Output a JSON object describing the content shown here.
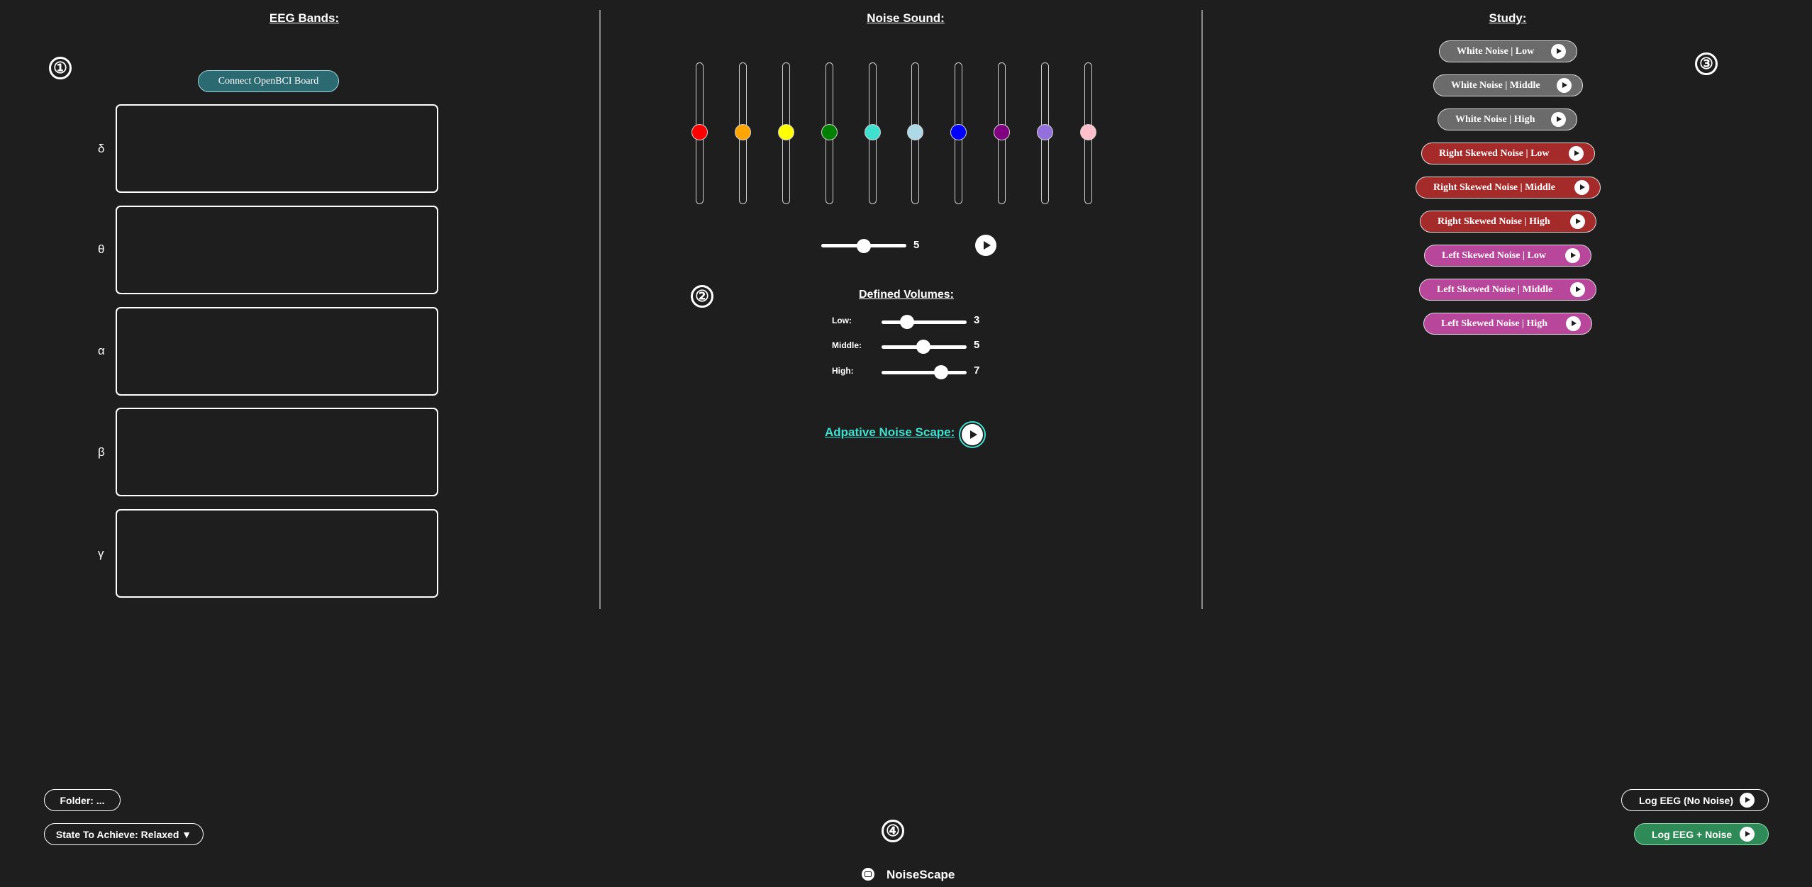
{
  "sections": {
    "eeg_title": "EEG Bands:",
    "noise_title": "Noise Sound:",
    "study_title": "Study:"
  },
  "markers": [
    "①",
    "②",
    "③",
    "④"
  ],
  "eeg": {
    "connect_label": "Connect OpenBCI Board",
    "bands": [
      "δ",
      "θ",
      "α",
      "β",
      "γ"
    ]
  },
  "noise": {
    "slider_colors": [
      "#ff0000",
      "#ffa500",
      "#ffff00",
      "#008000",
      "#40e0d0",
      "#add8e6",
      "#0000ff",
      "#800080",
      "#9370db",
      "#ffc0cb"
    ],
    "master_volume": "5",
    "defined_volumes_title": "Defined Volumes:",
    "volumes": [
      {
        "label": "Low:",
        "value": "3"
      },
      {
        "label": "Middle:",
        "value": "5"
      },
      {
        "label": "High:",
        "value": "7"
      }
    ],
    "adaptive_label": "Adpative Noise Scape:",
    "adaptive_color": "#40e0d0"
  },
  "study": {
    "buttons": [
      {
        "label": "White Noise | Low",
        "color": "#6b6b6b"
      },
      {
        "label": "White Noise | Middle",
        "color": "#6b6b6b"
      },
      {
        "label": "White Noise | High",
        "color": "#6b6b6b"
      },
      {
        "label": "Right Skewed Noise | Low",
        "color": "#a52a2a"
      },
      {
        "label": "Right Skewed Noise | Middle",
        "color": "#a52a2a"
      },
      {
        "label": "Right Skewed Noise | High",
        "color": "#a52a2a"
      },
      {
        "label": "Left Skewed Noise | Low",
        "color": "#b8479b"
      },
      {
        "label": "Left Skewed Noise | Middle",
        "color": "#b8479b"
      },
      {
        "label": "Left Skewed Noise | High",
        "color": "#b8479b"
      }
    ]
  },
  "footer": {
    "folder_label": "Folder: ...",
    "state_label": "State To Achieve: Relaxed ▼",
    "log_no_noise": "Log EEG (No Noise)",
    "log_noise": "Log EEG + Noise",
    "log_noise_color": "#2e8b57",
    "brand": "NoiseScape"
  }
}
